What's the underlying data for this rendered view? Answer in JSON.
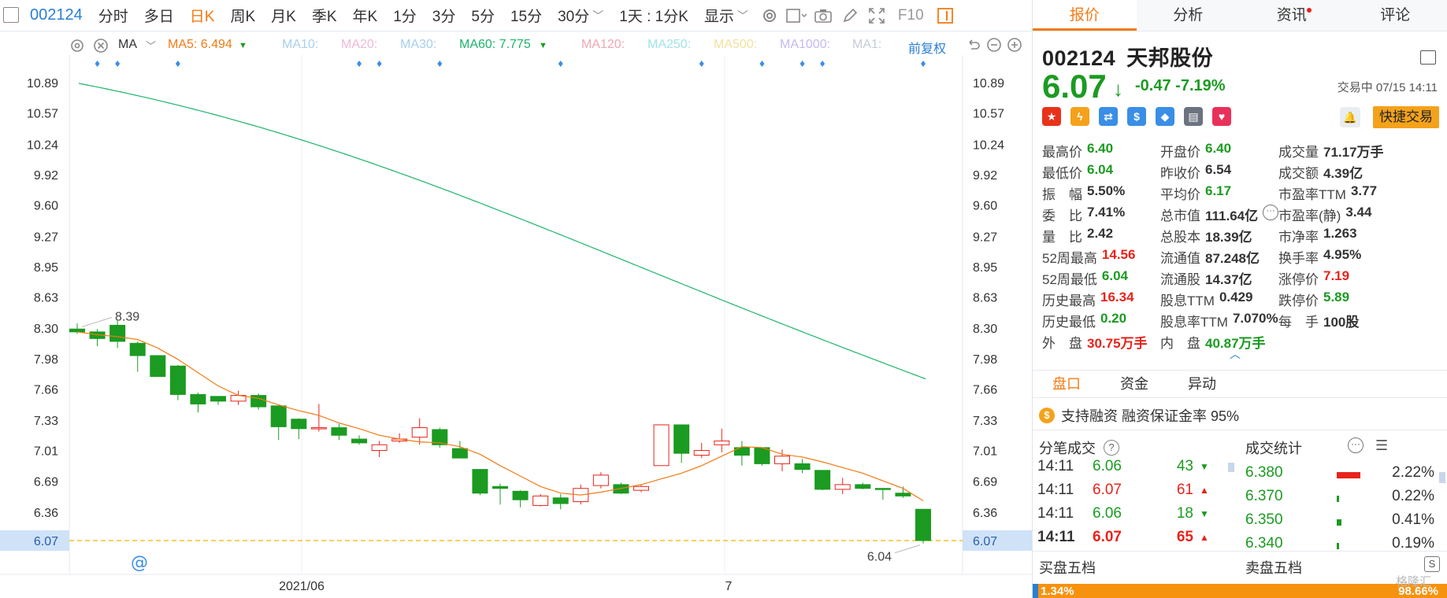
{
  "toolbar": {
    "code": "002124",
    "periods": [
      "分时",
      "多日",
      "日K",
      "周K",
      "月K",
      "季K",
      "年K",
      "1分",
      "3分",
      "5分",
      "15分",
      "30分"
    ],
    "active_period": "日K",
    "range_select": "1天 : 1分K",
    "display_select": "显示",
    "f10_label": "F10"
  },
  "mabar": {
    "indicator": "MA",
    "ma5": "MA5: 6.494",
    "ma10": "MA10:",
    "ma20": "MA20:",
    "ma30": "MA30:",
    "ma60": "MA60: 7.775",
    "ma120": "MA120:",
    "ma250": "MA250:",
    "ma500": "MA500:",
    "ma1000": "MA1000:",
    "ma1": "MA1:",
    "adjust": "前复权",
    "colors": {
      "ma5": "#f27b15",
      "ma60": "#1db36b",
      "ma10": "#9ec9ee",
      "ma20": "#f0b8d8",
      "ma30": "#9ec9ee",
      "ma120": "#f2a7b4",
      "ma250": "#9fe3ee",
      "ma500": "#f4e0a0",
      "ma1000": "#c5b9ee",
      "ma1": "#c5ccd6"
    }
  },
  "chart_data": {
    "type": "candlestick",
    "yticks": [
      "10.89",
      "10.57",
      "10.24",
      "9.92",
      "9.60",
      "9.27",
      "8.95",
      "8.63",
      "8.30",
      "7.98",
      "7.66",
      "7.33",
      "7.01",
      "6.69",
      "6.36",
      "6.07"
    ],
    "ylim": [
      6.07,
      10.89
    ],
    "xlabels": [
      "2021/06",
      "7"
    ],
    "current_price_label": "6.07",
    "high_annotation": "8.39",
    "low_annotation": "6.04",
    "candles": [
      {
        "o": 8.3,
        "c": 8.27,
        "h": 8.36,
        "l": 8.25
      },
      {
        "o": 8.27,
        "c": 8.2,
        "h": 8.3,
        "l": 8.12
      },
      {
        "o": 8.34,
        "c": 8.17,
        "h": 8.39,
        "l": 8.1
      },
      {
        "o": 8.15,
        "c": 8.02,
        "h": 8.17,
        "l": 7.85
      },
      {
        "o": 8.02,
        "c": 7.8,
        "h": 8.02,
        "l": 7.8
      },
      {
        "o": 7.91,
        "c": 7.61,
        "h": 7.92,
        "l": 7.55
      },
      {
        "o": 7.61,
        "c": 7.51,
        "h": 7.63,
        "l": 7.42
      },
      {
        "o": 7.59,
        "c": 7.54,
        "h": 7.59,
        "l": 7.5
      },
      {
        "o": 7.54,
        "c": 7.6,
        "h": 7.65,
        "l": 7.5
      },
      {
        "o": 7.6,
        "c": 7.48,
        "h": 7.62,
        "l": 7.45
      },
      {
        "o": 7.49,
        "c": 7.27,
        "h": 7.49,
        "l": 7.13
      },
      {
        "o": 7.35,
        "c": 7.25,
        "h": 7.36,
        "l": 7.14
      },
      {
        "o": 7.26,
        "c": 7.26,
        "h": 7.51,
        "l": 7.22
      },
      {
        "o": 7.26,
        "c": 7.18,
        "h": 7.3,
        "l": 7.13
      },
      {
        "o": 7.14,
        "c": 7.1,
        "h": 7.18,
        "l": 7.08
      },
      {
        "o": 7.02,
        "c": 7.08,
        "h": 7.12,
        "l": 6.95
      },
      {
        "o": 7.12,
        "c": 7.14,
        "h": 7.2,
        "l": 7.1
      },
      {
        "o": 7.16,
        "c": 7.26,
        "h": 7.36,
        "l": 7.08
      },
      {
        "o": 7.24,
        "c": 7.08,
        "h": 7.26,
        "l": 7.05
      },
      {
        "o": 7.04,
        "c": 6.94,
        "h": 7.12,
        "l": 6.94
      },
      {
        "o": 6.82,
        "c": 6.57,
        "h": 6.82,
        "l": 6.55
      },
      {
        "o": 6.64,
        "c": 6.62,
        "h": 6.67,
        "l": 6.45
      },
      {
        "o": 6.59,
        "c": 6.5,
        "h": 6.6,
        "l": 6.42
      },
      {
        "o": 6.44,
        "c": 6.54,
        "h": 6.56,
        "l": 6.43
      },
      {
        "o": 6.52,
        "c": 6.46,
        "h": 6.56,
        "l": 6.4
      },
      {
        "o": 6.48,
        "c": 6.62,
        "h": 6.66,
        "l": 6.45
      },
      {
        "o": 6.65,
        "c": 6.76,
        "h": 6.79,
        "l": 6.62
      },
      {
        "o": 6.66,
        "c": 6.57,
        "h": 6.68,
        "l": 6.56
      },
      {
        "o": 6.6,
        "c": 6.64,
        "h": 6.66,
        "l": 6.58
      },
      {
        "o": 6.86,
        "c": 7.29,
        "h": 7.29,
        "l": 6.86
      },
      {
        "o": 7.29,
        "c": 6.99,
        "h": 7.29,
        "l": 6.89
      },
      {
        "o": 6.97,
        "c": 7.02,
        "h": 7.1,
        "l": 6.94
      },
      {
        "o": 7.08,
        "c": 7.12,
        "h": 7.25,
        "l": 7.0
      },
      {
        "o": 7.05,
        "c": 6.97,
        "h": 7.12,
        "l": 6.86
      },
      {
        "o": 7.05,
        "c": 6.88,
        "h": 7.05,
        "l": 6.86
      },
      {
        "o": 6.88,
        "c": 6.96,
        "h": 7.03,
        "l": 6.8
      },
      {
        "o": 6.88,
        "c": 6.82,
        "h": 6.93,
        "l": 6.78
      },
      {
        "o": 6.81,
        "c": 6.61,
        "h": 6.81,
        "l": 6.6
      },
      {
        "o": 6.61,
        "c": 6.66,
        "h": 6.73,
        "l": 6.56
      },
      {
        "o": 6.66,
        "c": 6.62,
        "h": 6.68,
        "l": 6.61
      },
      {
        "o": 6.62,
        "c": 6.61,
        "h": 6.62,
        "l": 6.5
      },
      {
        "o": 6.57,
        "c": 6.54,
        "h": 6.64,
        "l": 6.52
      },
      {
        "o": 6.4,
        "c": 6.07,
        "h": 6.4,
        "l": 6.04
      }
    ],
    "ma5": [
      8.27,
      8.24,
      8.22,
      8.19,
      8.1,
      7.98,
      7.84,
      7.7,
      7.6,
      7.57,
      7.5,
      7.44,
      7.39,
      7.31,
      7.25,
      7.18,
      7.14,
      7.11,
      7.1,
      7.06,
      6.98,
      6.86,
      6.75,
      6.64,
      6.57,
      6.55,
      6.58,
      6.62,
      6.66,
      6.72,
      6.78,
      6.86,
      6.96,
      7.06,
      7.05,
      6.98,
      6.95,
      6.9,
      6.84,
      6.78,
      6.7,
      6.62,
      6.49
    ],
    "ma60_start": 10.89,
    "ma60_end": 7.775
  },
  "panel": {
    "tabs": [
      "报价",
      "分析",
      "资讯",
      "评论"
    ],
    "active_tab": "报价",
    "code": "002124",
    "name": "天邦股份",
    "price": "6.07",
    "change": "-0.47",
    "change_pct": "-7.19%",
    "status": "交易中 07/15 14:11",
    "quick_trade": "快捷交易",
    "stats": [
      [
        {
          "l": "最高价",
          "v": "6.40",
          "c": "dn"
        },
        {
          "l": "开盘价",
          "v": "6.40",
          "c": "dn"
        },
        {
          "l": "成交量",
          "v": "71.17万手",
          "c": "nt"
        }
      ],
      [
        {
          "l": "最低价",
          "v": "6.04",
          "c": "dn"
        },
        {
          "l": "昨收价",
          "v": "6.54",
          "c": "nt"
        },
        {
          "l": "成交额",
          "v": "4.39亿",
          "c": "nt"
        }
      ],
      [
        {
          "l": "振　幅",
          "v": "5.50%",
          "c": "nt"
        },
        {
          "l": "平均价",
          "v": "6.17",
          "c": "dn"
        },
        {
          "l": "市盈率TTM",
          "v": "3.77",
          "c": "nt"
        }
      ],
      [
        {
          "l": "委　比",
          "v": "7.41%",
          "c": "nt"
        },
        {
          "l": "总市值",
          "v": "111.64亿",
          "c": "nt"
        },
        {
          "l": "市盈率(静)",
          "v": "3.44",
          "c": "nt"
        }
      ],
      [
        {
          "l": "量　比",
          "v": "2.42",
          "c": "nt"
        },
        {
          "l": "总股本",
          "v": "18.39亿",
          "c": "nt"
        },
        {
          "l": "市净率",
          "v": "1.263",
          "c": "nt"
        }
      ],
      [
        {
          "l": "52周最高",
          "v": "14.56",
          "c": "up"
        },
        {
          "l": "流通值",
          "v": "87.248亿",
          "c": "nt"
        },
        {
          "l": "换手率",
          "v": "4.95%",
          "c": "nt"
        }
      ],
      [
        {
          "l": "52周最低",
          "v": "6.04",
          "c": "dn"
        },
        {
          "l": "流通股",
          "v": "14.37亿",
          "c": "nt"
        },
        {
          "l": "涨停价",
          "v": "7.19",
          "c": "up"
        }
      ],
      [
        {
          "l": "历史最高",
          "v": "16.34",
          "c": "up"
        },
        {
          "l": "股息TTM",
          "v": "0.429",
          "c": "nt"
        },
        {
          "l": "跌停价",
          "v": "5.89",
          "c": "dn"
        }
      ],
      [
        {
          "l": "历史最低",
          "v": "0.20",
          "c": "dn"
        },
        {
          "l": "股息率TTM",
          "v": "7.070%",
          "c": "nt"
        },
        {
          "l": "每　手",
          "v": "100股",
          "c": "nt"
        }
      ],
      [
        {
          "l": "外　盘",
          "v": "30.75万手",
          "c": "up"
        },
        {
          "l": "内　盘",
          "v": "40.87万手",
          "c": "dn"
        }
      ]
    ],
    "subtabs": [
      "盘口",
      "资金",
      "异动"
    ],
    "active_subtab": "盘口",
    "margin_text": "支持融资 融资保证金率 95%",
    "ticks_title": "分笔成交",
    "ticks": [
      {
        "t": "14:11",
        "p": "6.06",
        "v": "43",
        "d": "down"
      },
      {
        "t": "14:11",
        "p": "6.07",
        "v": "61",
        "d": "up"
      },
      {
        "t": "14:11",
        "p": "6.06",
        "v": "18",
        "d": "down"
      },
      {
        "t": "14:11",
        "p": "6.07",
        "v": "65",
        "d": "up"
      }
    ],
    "volstat_title": "成交统计",
    "volstats": [
      {
        "p": "6.380",
        "pct": "2.22%",
        "w": 2.22
      },
      {
        "p": "6.370",
        "pct": "0.22%",
        "w": 0.22
      },
      {
        "p": "6.350",
        "pct": "0.41%",
        "w": 0.41
      },
      {
        "p": "6.340",
        "pct": "0.19%",
        "w": 0.19
      }
    ],
    "buy_book": "买盘五档",
    "sell_book": "卖盘五档",
    "buy_pct": "1.34%",
    "sell_pct": "98.66%",
    "watermark": "格隆汇"
  }
}
